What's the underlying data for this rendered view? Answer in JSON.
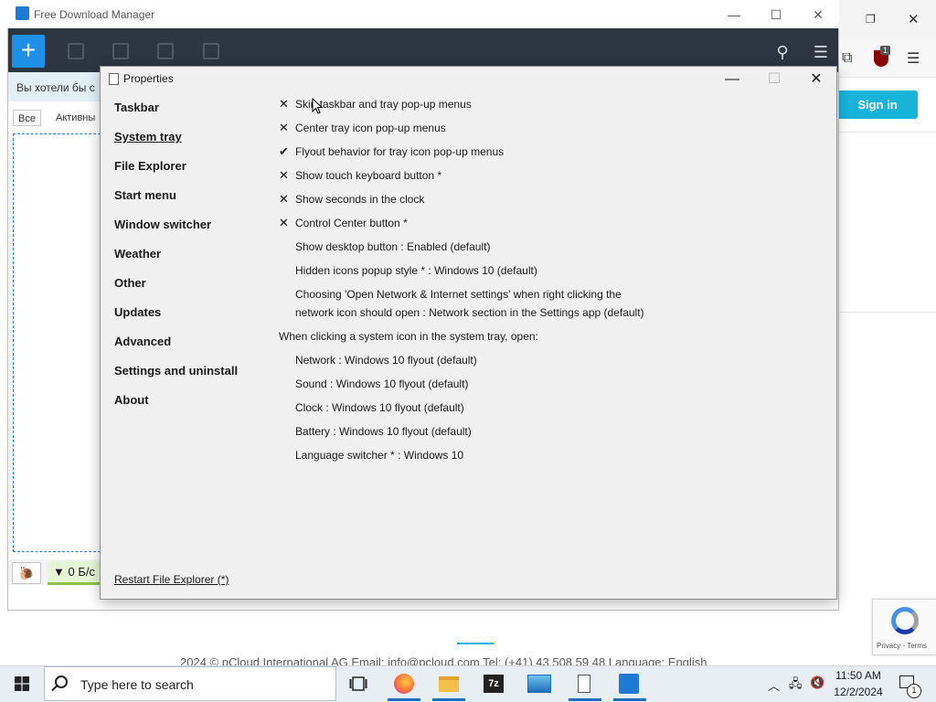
{
  "browser": {
    "signin_label": "Sign in",
    "extension_badge": "1",
    "recaptcha_text": "Privacy - Terms",
    "footer_text": "2024 © pCloud International AG Email: info@pcloud.com  Tel: (+41) 43 508 59 48   Language: English"
  },
  "fdm": {
    "title": "Free Download Manager",
    "banner_text": "Вы хотели бы с",
    "tabs": [
      {
        "label": "Все",
        "active": true
      },
      {
        "label": "Активны",
        "active": false
      }
    ],
    "speed": "▼ 0 Б/с"
  },
  "dialog": {
    "title": "Properties",
    "nav": [
      {
        "label": "Taskbar"
      },
      {
        "label": "System tray",
        "current": true
      },
      {
        "label": "File Explorer"
      },
      {
        "label": "Start menu"
      },
      {
        "label": "Window switcher"
      },
      {
        "label": "Weather"
      },
      {
        "label": "Other"
      },
      {
        "label": "Updates"
      },
      {
        "label": "Advanced"
      },
      {
        "label": "Settings and uninstall"
      },
      {
        "label": "About"
      }
    ],
    "options": [
      {
        "mark": "✕",
        "label": "Skin taskbar and tray pop-up menus"
      },
      {
        "mark": "✕",
        "label": "Center tray icon pop-up menus"
      },
      {
        "mark": "✔",
        "label": "Flyout behavior for tray icon pop-up menus"
      },
      {
        "mark": "✕",
        "label": "Show touch keyboard button *"
      },
      {
        "mark": "✕",
        "label": "Show seconds in the clock"
      },
      {
        "mark": "✕",
        "label": "Control Center button *"
      }
    ],
    "settings": [
      {
        "label": "Show desktop button : Enabled (default)"
      },
      {
        "label": "Hidden icons popup style * : Windows 10 (default)"
      },
      {
        "label": "Choosing 'Open Network & Internet settings' when right clicking the"
      },
      {
        "label": "network icon should open : Network section in the Settings app (default)"
      }
    ],
    "section_heading": "When clicking a system icon in the system tray, open:",
    "tray_settings": [
      {
        "label": "Network : Windows 10 flyout (default)"
      },
      {
        "label": "Sound : Windows 10 flyout (default)"
      },
      {
        "label": "Clock : Windows 10 flyout (default)"
      },
      {
        "label": "Battery : Windows 10 flyout (default)"
      },
      {
        "label": "Language switcher * : Windows 10"
      }
    ],
    "restart_link": "Restart File Explorer (*)"
  },
  "taskbar": {
    "search_placeholder": "Type here to search",
    "apps": [
      "task-view",
      "firefox",
      "file-explorer",
      "7zip",
      "photos",
      "properties",
      "free-download-manager"
    ],
    "time": "11:50 AM",
    "date": "12/2/2024",
    "notification_count": "1"
  },
  "colors": {
    "accent": "#1e90e8",
    "fdm_toolbar": "#2c3540",
    "signin": "#17b3d8",
    "dialog_bg": "#f0f0f0"
  }
}
